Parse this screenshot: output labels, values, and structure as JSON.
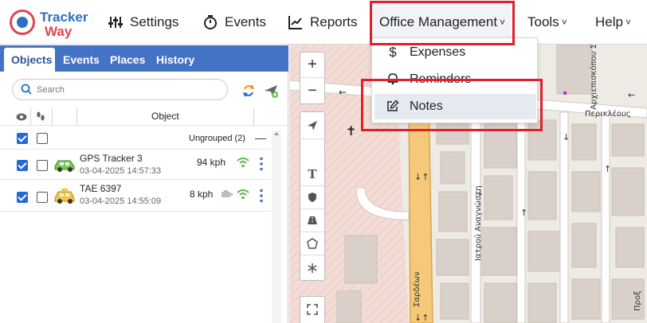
{
  "brand": {
    "line1": "Tracker",
    "line2": "Way"
  },
  "nav": {
    "settings": "Settings",
    "events": "Events",
    "reports": "Reports",
    "office": "Office Management",
    "tools": "Tools",
    "help": "Help"
  },
  "dropdown": {
    "items": [
      {
        "label": "Expenses",
        "icon": "dollar-icon"
      },
      {
        "label": "Reminders",
        "icon": "bell-icon"
      },
      {
        "label": "Notes",
        "icon": "edit-note-icon"
      }
    ]
  },
  "tabs": [
    "Objects",
    "Events",
    "Places",
    "History"
  ],
  "search": {
    "placeholder": "Search"
  },
  "table": {
    "object_header": "Object"
  },
  "group": {
    "label": "Ungrouped (2)"
  },
  "objects": [
    {
      "name": "GPS Tracker 3",
      "time": "03-04-2025 14:57:33",
      "speed": "94 kph",
      "car_color": "#7cc84a",
      "checked": true
    },
    {
      "name": "TAE 6397",
      "time": "03-04-2025 14:55:09",
      "speed": "8 kph",
      "car_color": "#f3c441",
      "checked": true
    }
  ],
  "map": {
    "street_labels": [
      "Περικλέους",
      "Αρχιεπισκόπου Σ",
      "Ιατρού Αναγνώστη",
      "Σαρδέων",
      "Προξ"
    ],
    "route_marker": "↓↑"
  },
  "colors": {
    "accent": "#4472c4",
    "highlight": "#e0202a",
    "road": "#f6c97a"
  }
}
